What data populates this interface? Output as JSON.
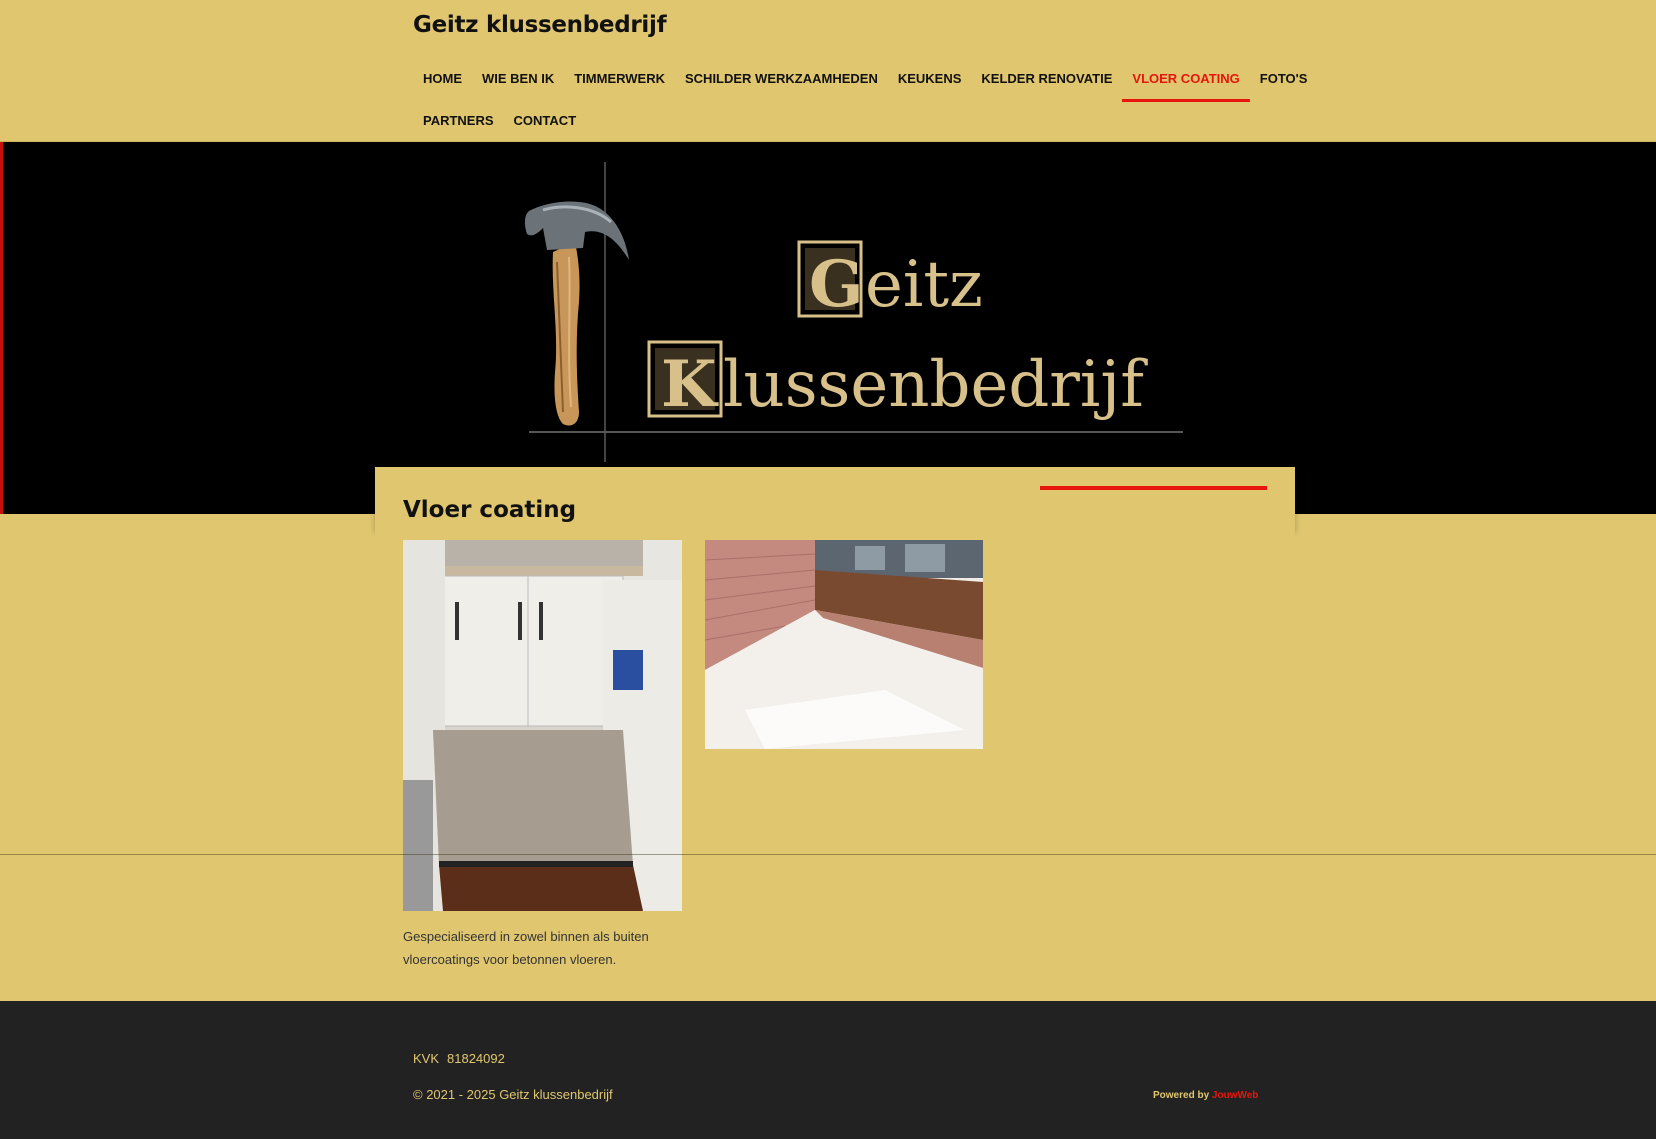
{
  "header": {
    "site_title": "Geitz klussenbedrijf",
    "nav_row1": [
      "HOME",
      "WIE BEN IK",
      "TIMMERWERK",
      "SCHILDER WERKZAAMHEDEN",
      "KEUKENS",
      "KELDER RENOVATIE",
      "VLOER COATING",
      "FOTO'S"
    ],
    "nav_row2": [
      "PARTNERS",
      "CONTACT"
    ],
    "active_item": "VLOER COATING"
  },
  "hero": {
    "logo_word1": "Geitz",
    "logo_word2": "Klussenbedrijf",
    "logo_icon": "hammer-icon"
  },
  "main": {
    "heading": "Vloer coating",
    "description": "Gespecialiseerd in zowel binnen als buiten vloercoatings voor betonnen vloeren."
  },
  "footer": {
    "kvk_label": "KVK",
    "kvk_number": "81824092",
    "copyright": "© 2021 - 2025 Geitz klussenbedrijf",
    "powered_by": "Powered by",
    "powered_brand": "JouwWeb"
  },
  "colors": {
    "background": "#e0c76f",
    "accent": "#e6160d",
    "hero": "#000000",
    "footer": "#222222",
    "logo_gold": "#d8c08a"
  }
}
